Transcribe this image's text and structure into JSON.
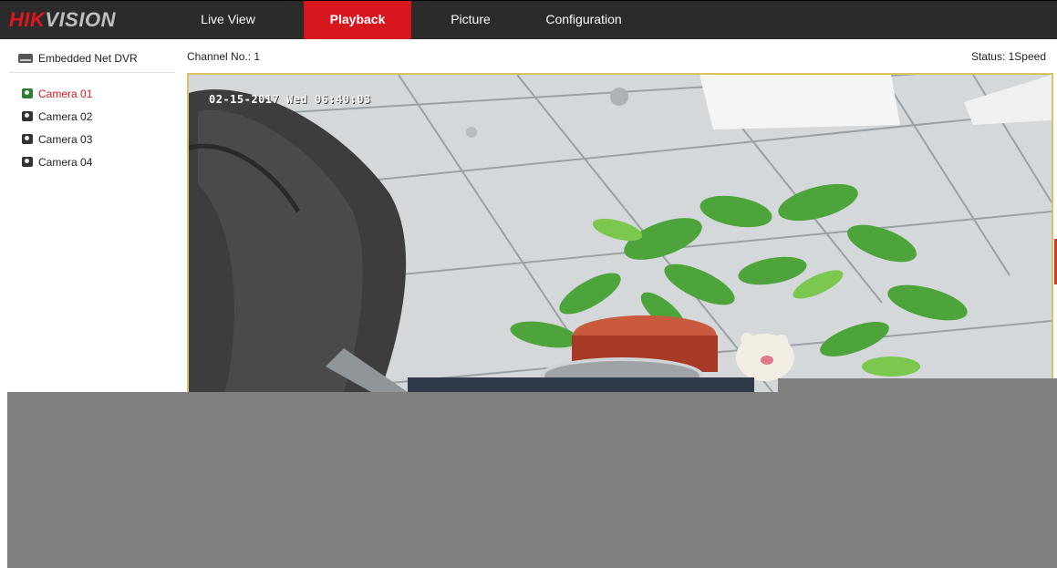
{
  "brand": {
    "part1": "HIK",
    "part2": "VISION"
  },
  "nav": {
    "tabs": [
      {
        "label": "Live View"
      },
      {
        "label": "Playback"
      },
      {
        "label": "Picture"
      },
      {
        "label": "Configuration"
      }
    ],
    "active": "Playback"
  },
  "sidebar": {
    "device": "Embedded Net DVR",
    "cameras": [
      "Camera 01",
      "Camera 02",
      "Camera 03",
      "Camera 04"
    ],
    "selected": "Camera 01"
  },
  "player": {
    "channel": "Channel No.: 1",
    "status": "Status: 1Speed",
    "osd": "02-15-2017 Wed 06:40:03"
  },
  "colors": {
    "accent": "#d8161e",
    "nav_bg": "#2b2b2b",
    "frame": "#d9c25f",
    "overlay": "#808080"
  }
}
